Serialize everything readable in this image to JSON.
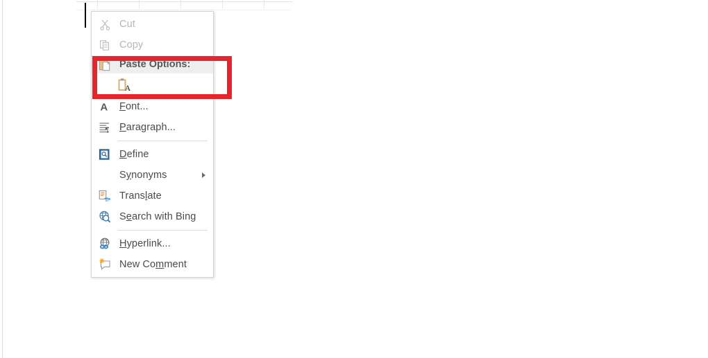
{
  "document": {
    "caret_visible": true,
    "background_color": "#ffffff",
    "page_border_color": "#dcdcdc"
  },
  "annotation": {
    "highlight_color": "#e8232a",
    "target": "Paste Options:",
    "border_width_px": 7
  },
  "context_menu": {
    "background_color": "#ffffff",
    "border_color": "#d4d4d4",
    "highlight_row_color": "#eeeeee",
    "items": [
      {
        "label": "Cut",
        "icon": "scissors-icon",
        "disabled": true,
        "accel": "t",
        "has_submenu": false
      },
      {
        "label": "Copy",
        "icon": "copy-documents-icon",
        "disabled": true,
        "accel": "C",
        "has_submenu": false
      },
      {
        "label": "Font...",
        "icon": "font-letter-a-icon",
        "disabled": false,
        "accel": "F",
        "has_submenu": false
      },
      {
        "label": "Paragraph...",
        "icon": "paragraph-pilcrow-icon",
        "disabled": false,
        "accel": "P",
        "has_submenu": false
      },
      {
        "label": "Define",
        "icon": "define-book-icon",
        "disabled": false,
        "accel": "D",
        "has_submenu": false
      },
      {
        "label": "Synonyms",
        "icon": "none",
        "disabled": false,
        "accel": "y",
        "has_submenu": true
      },
      {
        "label": "Translate",
        "icon": "translate-icon",
        "disabled": false,
        "accel": "l",
        "has_submenu": false
      },
      {
        "label": "Search with Bing",
        "icon": "search-globe-icon",
        "disabled": false,
        "accel": "e",
        "has_submenu": false
      },
      {
        "label": "Hyperlink...",
        "icon": "hyperlink-globe-icon",
        "disabled": false,
        "accel": "H",
        "has_submenu": false
      },
      {
        "label": "New Comment",
        "icon": "new-comment-icon",
        "disabled": false,
        "accel": "m",
        "has_submenu": false
      }
    ],
    "paste_options": {
      "header_label": "Paste Options:",
      "header_icon": "clipboard-icon",
      "buttons": [
        {
          "name": "keep-text-only",
          "icon": "clipboard-letter-a-icon",
          "letter": "A"
        }
      ]
    }
  }
}
